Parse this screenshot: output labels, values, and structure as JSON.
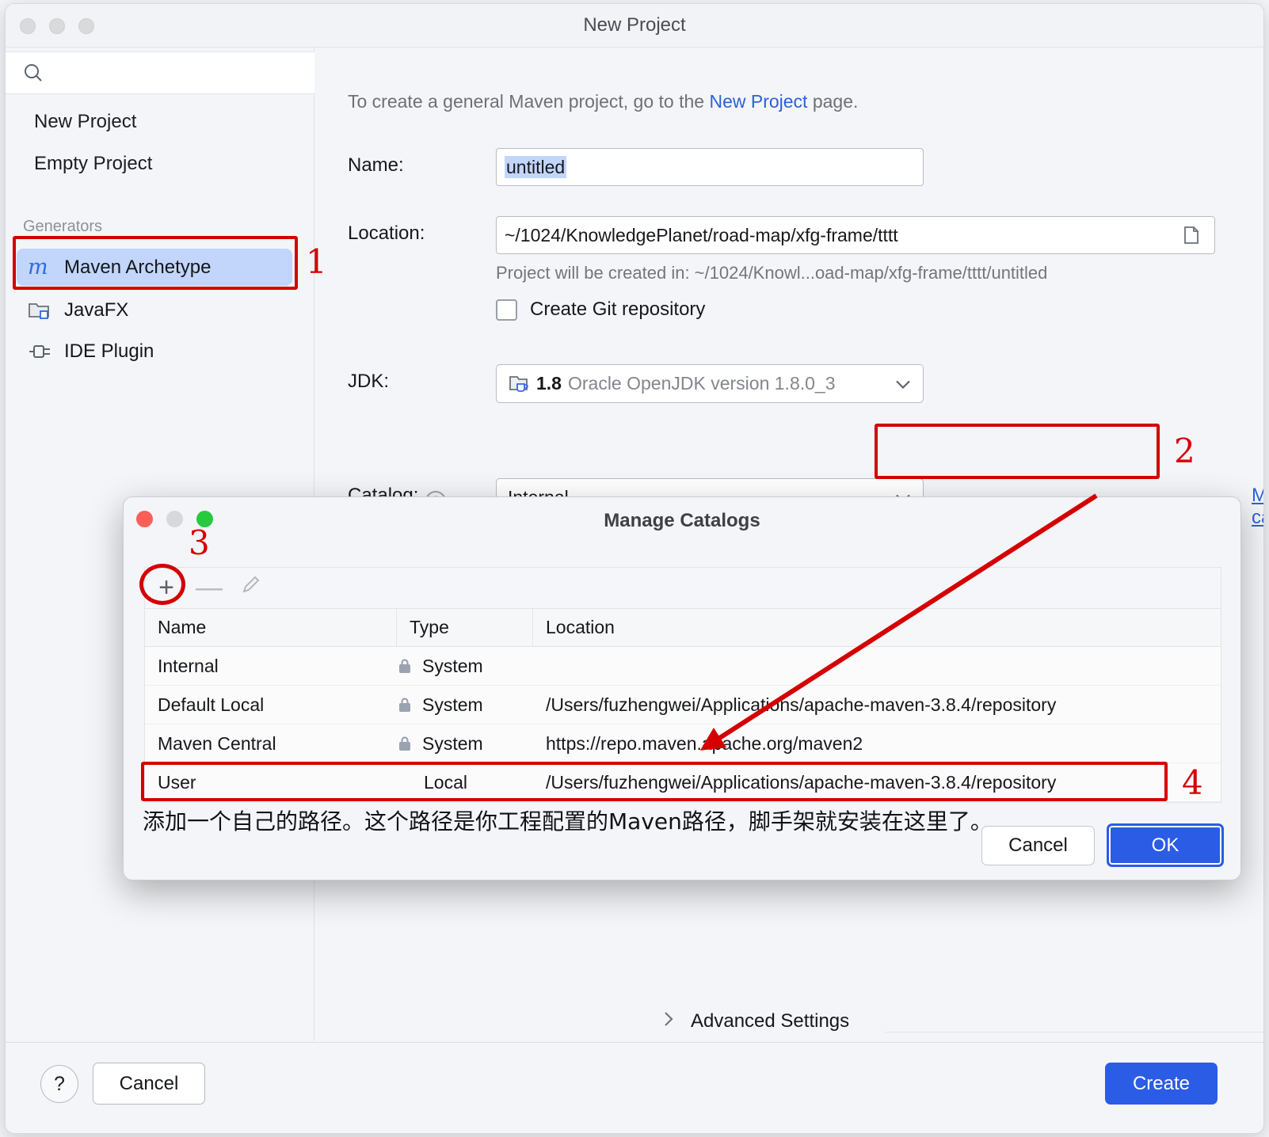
{
  "window": {
    "title": "New Project",
    "traffic_lights": [
      "close",
      "minimize",
      "zoom"
    ]
  },
  "sidebar": {
    "search": {
      "value": "",
      "placeholder": ""
    },
    "items": [
      {
        "label": "New Project"
      },
      {
        "label": "Empty Project"
      }
    ],
    "group_label": "Generators",
    "generators": [
      {
        "label": "Maven Archetype",
        "icon": "maven-m-icon",
        "selected": true
      },
      {
        "label": "JavaFX",
        "icon": "javafx-icon",
        "selected": false
      },
      {
        "label": "IDE Plugin",
        "icon": "plugin-icon",
        "selected": false
      }
    ]
  },
  "main": {
    "hint_prefix": "To create a general Maven project, go to the ",
    "hint_link": "New Project",
    "hint_suffix": " page.",
    "name_label": "Name:",
    "name_value": "untitled",
    "location_label": "Location:",
    "location_value": "~/1024/KnowledgePlanet/road-map/xfg-frame/tttt",
    "location_note": "Project will be created in: ~/1024/Knowl...oad-map/xfg-frame/tttt/untitled",
    "git_checkbox_label": "Create Git repository",
    "git_checked": false,
    "jdk_label": "JDK:",
    "jdk_version": "1.8",
    "jdk_description": "Oracle OpenJDK version 1.8.0_3",
    "catalog_label": "Catalog:",
    "catalog_help": "?",
    "catalog_value": "Internal",
    "manage_catalogs_link": "Manage catalogs...",
    "advanced_settings": "Advanced Settings"
  },
  "footer": {
    "help_label": "?",
    "cancel_label": "Cancel",
    "create_label": "Create"
  },
  "dialog": {
    "title": "Manage Catalogs",
    "toolbar": [
      {
        "name": "add",
        "glyph": "+"
      },
      {
        "name": "remove",
        "glyph": "—"
      },
      {
        "name": "edit",
        "glyph": "✎"
      }
    ],
    "columns": [
      "Name",
      "Type",
      "Location"
    ],
    "rows": [
      {
        "name": "Internal",
        "locked": true,
        "type": "System",
        "location": ""
      },
      {
        "name": "Default Local",
        "locked": true,
        "type": "System",
        "location": "/Users/fuzhengwei/Applications/apache-maven-3.8.4/repository"
      },
      {
        "name": "Maven Central",
        "locked": true,
        "type": "System",
        "location": "https://repo.maven.apache.org/maven2"
      },
      {
        "name": "User",
        "locked": false,
        "type": "Local",
        "location": "/Users/fuzhengwei/Applications/apache-maven-3.8.4/repository"
      }
    ],
    "note": "添加一个自己的路径。这个路径是你工程配置的Maven路径，脚手架就安装在这里了。",
    "cancel_label": "Cancel",
    "ok_label": "OK"
  },
  "annotations": {
    "color": "#d40000",
    "markers": [
      "1",
      "2",
      "3",
      "4"
    ]
  }
}
